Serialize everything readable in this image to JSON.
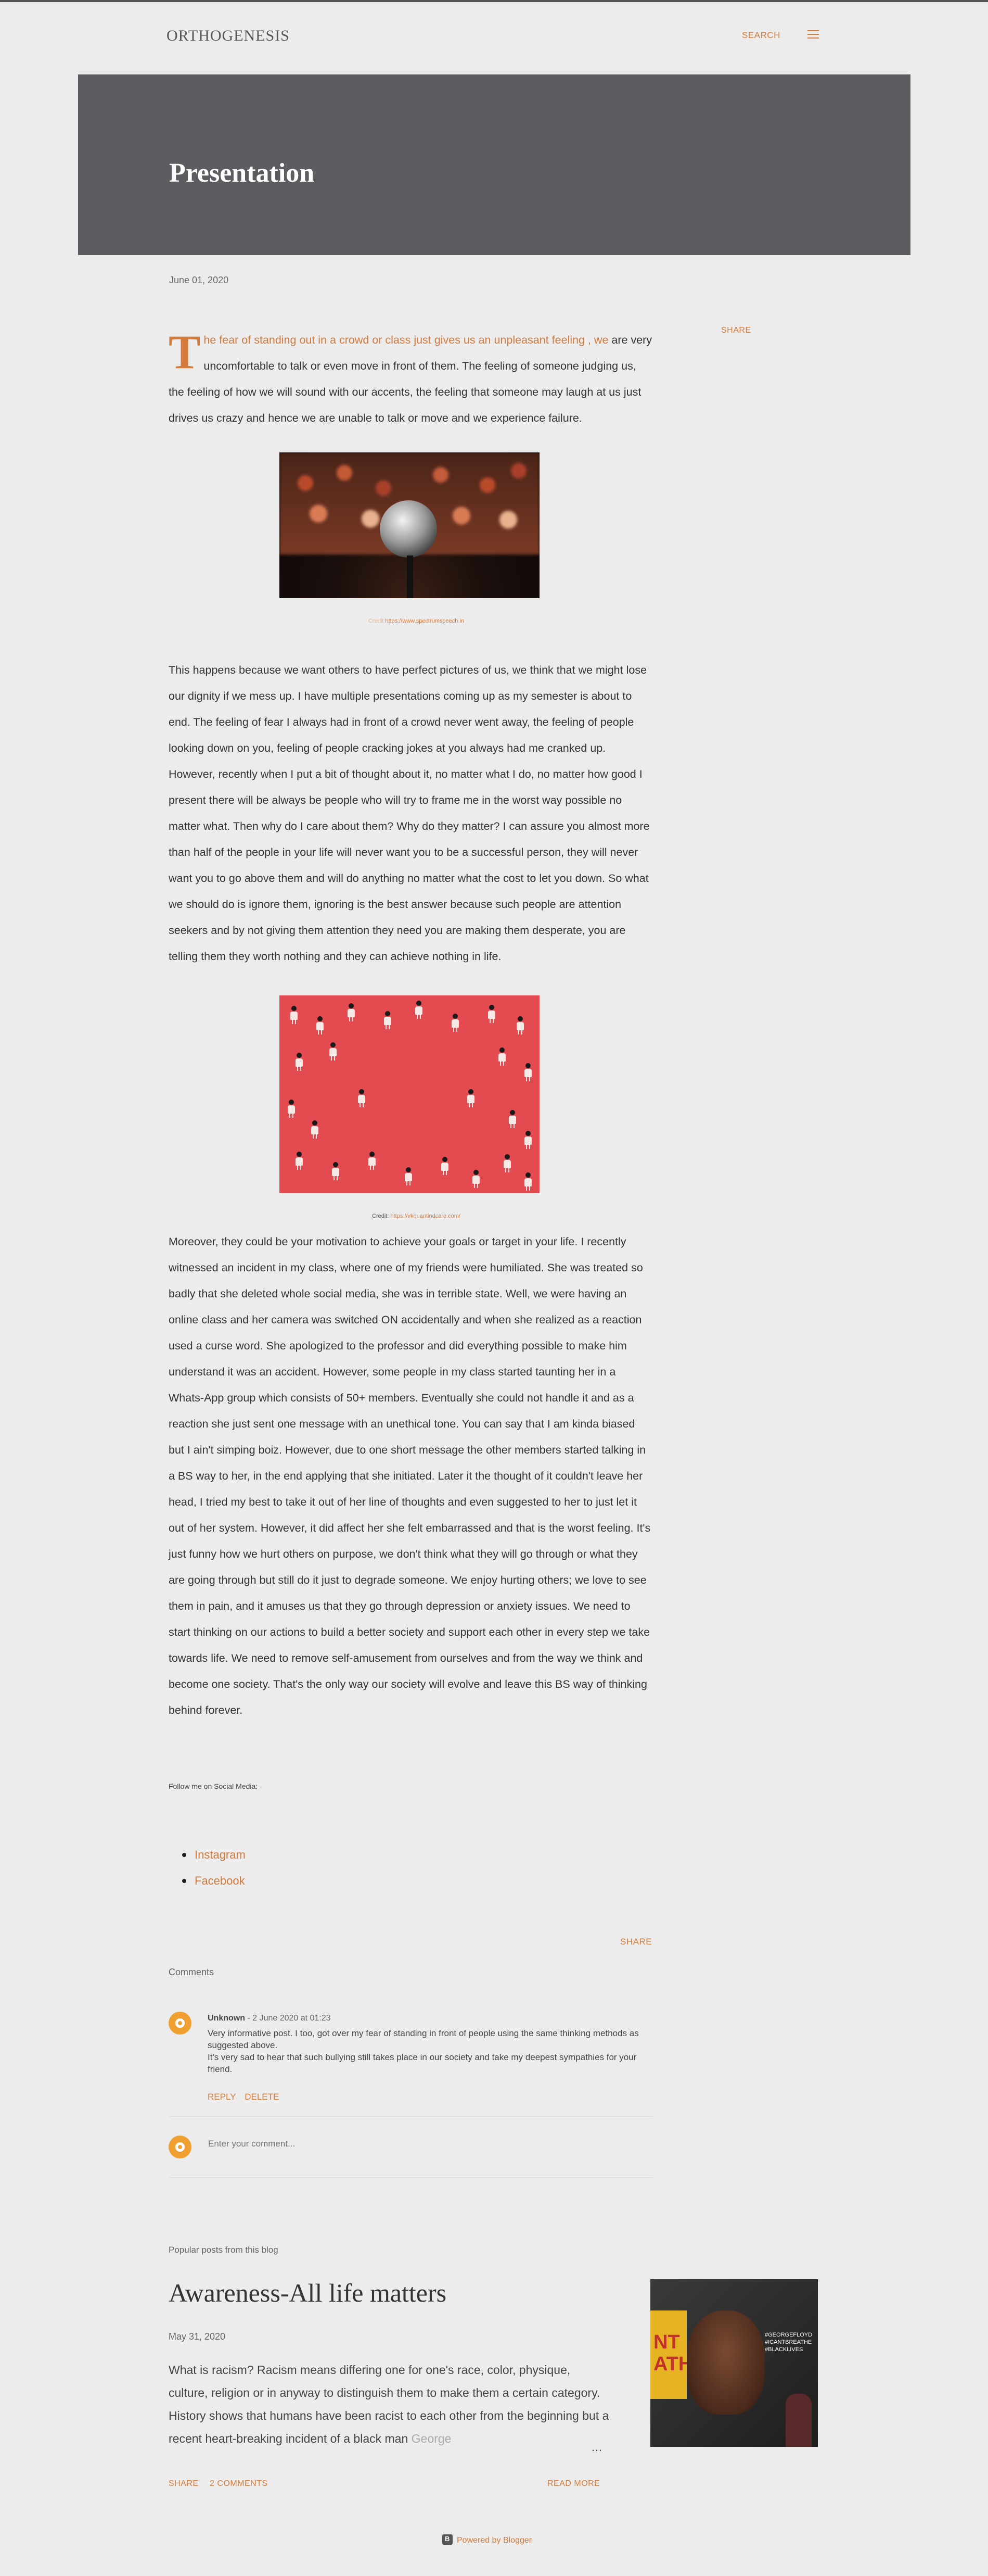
{
  "header": {
    "site_title": "ORTHOGENESIS",
    "search_label": "SEARCH",
    "menu_icon": "hamburger-menu-icon"
  },
  "hero": {
    "title": "Presentation"
  },
  "post": {
    "date": "June 01, 2020",
    "share_label": "SHARE",
    "dropcap": "T",
    "intro_highlight": "he fear of standing out in a crowd or class just gives us an unpleasant feeling , we",
    "intro_rest": " are very uncomfortable to talk or even move in front of them. The feeling of someone judging us, the feeling of how we will sound with our accents, the feeling that someone may laugh at us just drives us crazy and hence we are unable to talk or move and we experience failure.",
    "image1_caption_prefix": "Credit",
    "image1_caption_link": "https://www.spectrumspeech.in",
    "paragraph2": "This happens because we want others to have perfect pictures of us, we think that we might lose our dignity if we mess up. I have multiple presentations coming up as my semester is about to end. The feeling of fear I always had in front of a crowd never went away, the feeling of people looking down on you, feeling of people cracking jokes at you always had me cranked up. However, recently when I put a bit of thought about it, no matter what I do, no matter how good I present there will be always be people who will try to frame me in the worst way possible no matter what. Then why do I care about them? Why do they matter? I can assure you almost more than half of the people in your life will never want you to be a successful person, they will never want you to go above them and will do anything no matter what the cost to let you down. So what we should do is ignore them, ignoring is the best answer because such people are attention seekers and by not giving them attention they need you are making them desperate, you are telling them they worth nothing and they can achieve nothing in life.",
    "image2_caption_prefix": "Credit:",
    "image2_caption_link": "https://vkquantindcare.com/",
    "paragraph3": "Moreover, they could be your motivation to achieve your goals or target in your life. I recently witnessed an incident in my class, where one of my friends were humiliated. She was treated so badly that she deleted  whole social media, she was in terrible state. Well, we were having an online class and her camera was switched ON accidentally and when she realized as a reaction used a curse word. She apologized to the professor and did everything possible to make him understand it was an accident. However, some people in my class started taunting her in a Whats-App group which consists of 50+ members. Eventually she could not handle it  and as a reaction she just sent one message with an unethical tone. You can say that I am kinda biased but I ain't simping boiz. However, due to one short message the other members started talking in a BS way to her, in the end applying that she initiated. Later it the thought of it couldn't leave her head, I tried my best to take it out of her line of thoughts and even suggested to her to just let it out of her system. However, it did affect her she felt embarrassed and that is the worst feeling. It's just funny how we hurt others on purpose, we don't think what they will go through or what they are going through but still do it just to degrade someone. We enjoy hurting others; we love to see them in pain, and it amuses us that they go through depression or anxiety issues. We need to start thinking on our actions to build a better society and support each other in every step we take towards life. We need to remove self-amusement from ourselves and from the way we think and become one society. That's the only way our society will evolve and leave this BS way of thinking behind forever.",
    "follow_text": "Follow me on Social Media: -",
    "social_links": [
      "Instagram",
      "Facebook"
    ],
    "share_bottom_label": "SHARE"
  },
  "comments": {
    "title": "Comments",
    "items": [
      {
        "author": "Unknown",
        "time": " - 2 June 2020 at 01:23",
        "text_line1": "Very informative post. I too, got over my fear of standing in front of people using the same thinking methods as suggested above.",
        "text_line2": "It's very sad to hear that such bullying still takes place in our society and take my deepest sympathies for your friend.",
        "reply_label": "REPLY",
        "delete_label": "DELETE"
      }
    ],
    "input_placeholder": "Enter your comment..."
  },
  "popular": {
    "title": "Popular posts from this blog",
    "post_title": "Awareness-All life matters",
    "post_date": "May 31, 2020",
    "snippet": "What is racism? Racism means differing one for one's race, color, physique, culture, religion or in anyway to distinguish them to make them a certain category. History shows that humans have been racist to each other from the beginning but a recent heart-breaking incident of a black man ",
    "snippet_fade": "George",
    "ellipsis": "…",
    "image_text": "NT\nATHE",
    "image_tag": "#GEORGEFLOYD #ICANTBREATHE #BLACKLIVES",
    "share_label": "SHARE",
    "comments_label": "2 COMMENTS",
    "read_more_label": "READ MORE"
  },
  "footer": {
    "powered_by": "Powered by Blogger",
    "blogger_icon": "blogger-icon"
  },
  "colors": {
    "accent": "#d47a3a",
    "hero_bg": "#5d5c61",
    "page_bg": "#ececec",
    "avatar": "#f0a030"
  }
}
